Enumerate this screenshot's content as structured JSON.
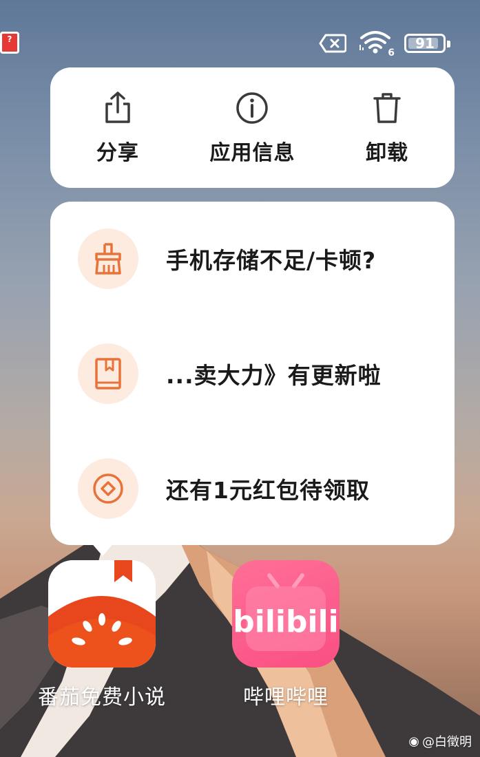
{
  "status_bar": {
    "battery_level": "91",
    "wifi_badge": "6",
    "left_icon": "app-notification-icon",
    "icons": [
      "sim-card-blocked-icon",
      "wifi-icon",
      "battery-icon"
    ]
  },
  "quick_actions": [
    {
      "label": "分享",
      "icon": "share-icon"
    },
    {
      "label": "应用信息",
      "icon": "info-icon"
    },
    {
      "label": "卸载",
      "icon": "trash-icon"
    }
  ],
  "shortcuts": [
    {
      "label": "手机存储不足/卡顿?",
      "icon": "broom-icon"
    },
    {
      "label": "...卖大力》有更新啦",
      "icon": "book-icon"
    },
    {
      "label": "还有1元红包待领取",
      "icon": "coin-icon"
    }
  ],
  "apps": [
    {
      "label": "番茄免费小说",
      "icon": "fanqie-novel-icon"
    },
    {
      "label": "哔哩哔哩",
      "icon": "bilibili-icon",
      "logo_text": "bilibili"
    }
  ],
  "watermark": {
    "text": "@白徵明",
    "icon": "weibo-icon"
  },
  "colors": {
    "accent_orange": "#e8733a",
    "shortcut_bg": "#fdebe0",
    "bilibili_pink": "#fb5a8a"
  }
}
